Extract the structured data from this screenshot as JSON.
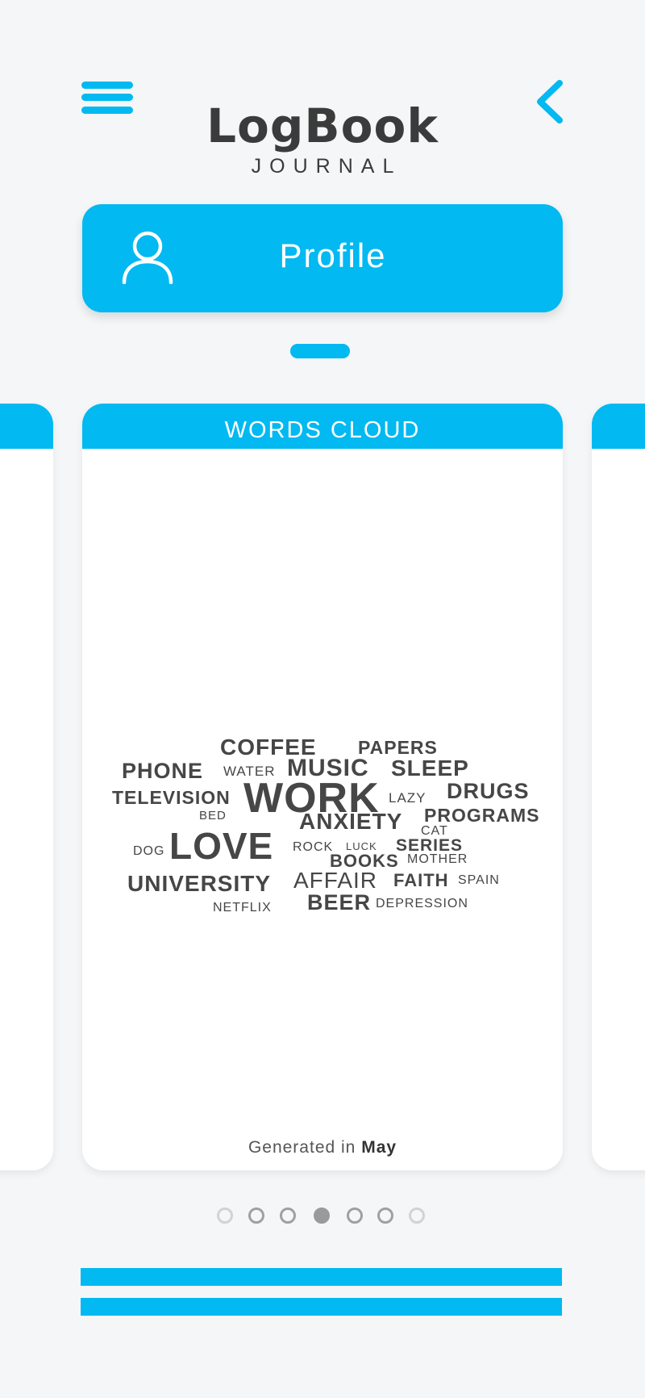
{
  "app": {
    "title": "LogBook",
    "subtitle": "JOURNAL"
  },
  "header": {
    "menu_icon": "hamburger-menu-icon",
    "back_icon": "chevron-left-icon"
  },
  "profile": {
    "label": "Profile",
    "icon": "user-icon"
  },
  "card": {
    "title": "WORDS CLOUD",
    "footer_prefix": "Generated in",
    "footer_month": "May",
    "words": [
      "COFFEE",
      "PAPERS",
      "PHONE",
      "WATER",
      "MUSIC",
      "SLEEP",
      "TELEVISION",
      "WORK",
      "LAZY",
      "DRUGS",
      "BED",
      "ANXIETY",
      "PROGRAMS",
      "CAT",
      "DOG",
      "LOVE",
      "ROCK",
      "LUCK",
      "SERIES",
      "BOOKS",
      "MOTHER",
      "UNIVERSITY",
      "AFFAIR",
      "FAITH",
      "SPAIN",
      "NETFLIX",
      "BEER",
      "DEPRESSION"
    ]
  },
  "pagination": {
    "total": 7,
    "active_index": 3
  },
  "colors": {
    "accent": "#02b9f1",
    "background": "#f4f6f8",
    "text": "#3b3b3b"
  }
}
